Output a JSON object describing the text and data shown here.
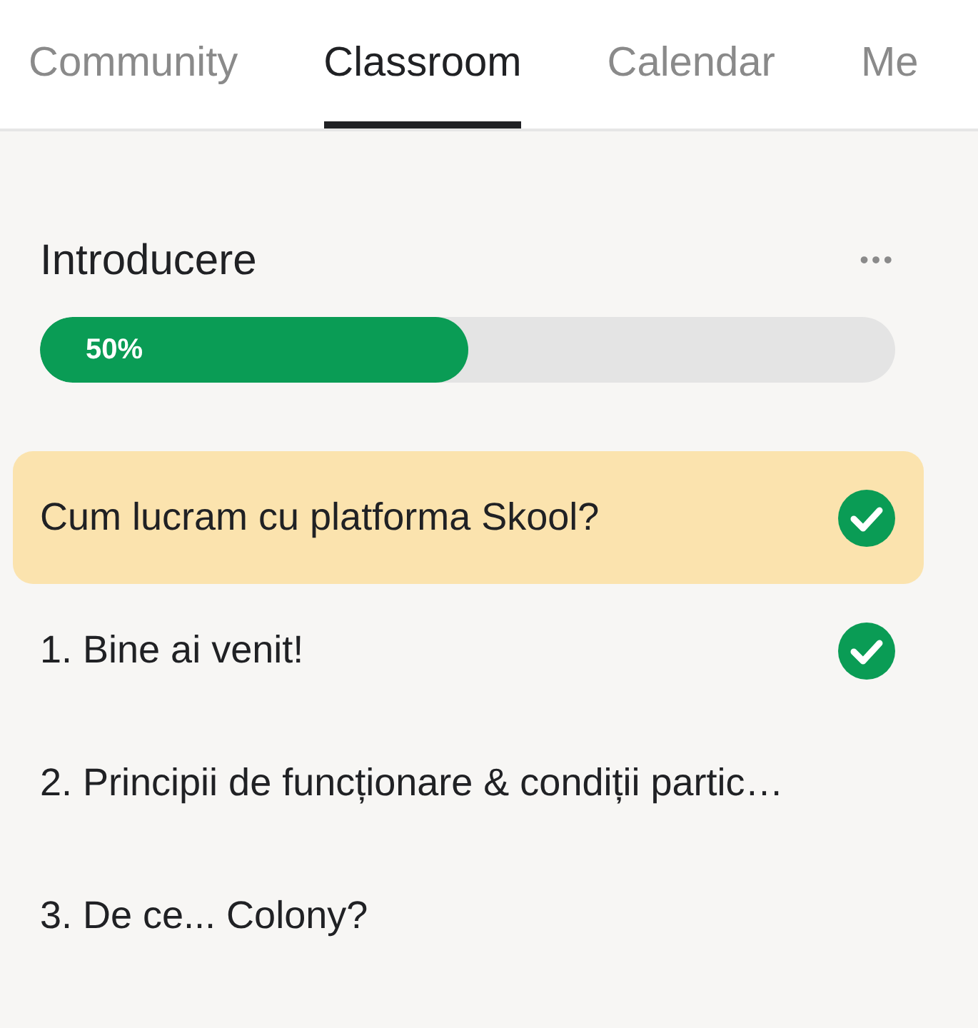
{
  "tabs": [
    {
      "label": "Community",
      "selected": false
    },
    {
      "label": "Classroom",
      "selected": true
    },
    {
      "label": "Calendar",
      "selected": false
    },
    {
      "label": "Me",
      "selected": false
    }
  ],
  "module": {
    "title": "Introducere",
    "more": "•••",
    "progress": {
      "level": 0.5,
      "reading": "50%"
    }
  },
  "lessons": [
    {
      "title": "Cum lucram cu platforma Skool?",
      "selected": true,
      "completed": true
    },
    {
      "title": "1. Bine ai venit!",
      "selected": false,
      "completed": true
    },
    {
      "title": "2. Principii de funcționare & condiții partic…",
      "selected": false,
      "completed": false
    },
    {
      "title": "3. De ce... Colony?",
      "selected": false,
      "completed": false
    }
  ]
}
